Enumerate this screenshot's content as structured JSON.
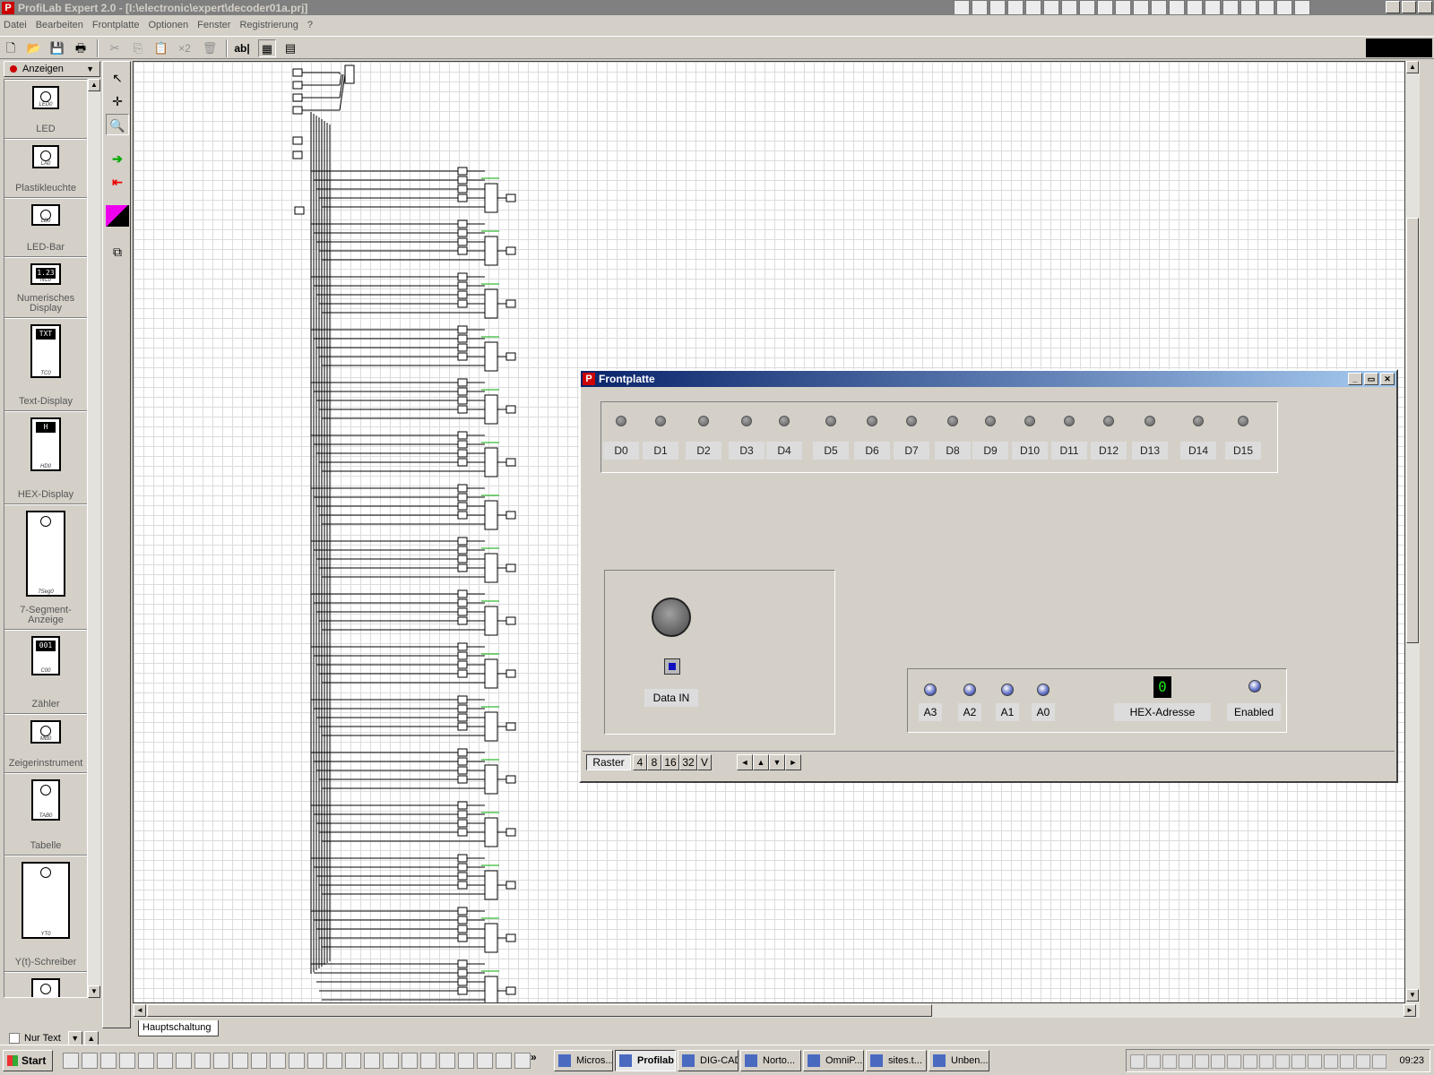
{
  "window": {
    "title": "ProfiLab Expert 2.0 - [I:\\electronic\\expert\\decoder01a.prj]",
    "app_icon": "P",
    "minimize": "_",
    "maximize": "▭",
    "close": "✕"
  },
  "menu": [
    "Datei",
    "Bearbeiten",
    "Frontplatte",
    "Optionen",
    "Fenster",
    "Registrierung",
    "?"
  ],
  "toolbar": {
    "new": "🗋",
    "open": "📂",
    "save": "💾",
    "print": "🖶",
    "cut": "✂",
    "copy": "⎘",
    "paste": "📋",
    "duplicate": "×2",
    "delete": "🗑",
    "text": "ab|",
    "grid1": "▦",
    "grid2": "▤"
  },
  "library": {
    "category": "Anzeigen",
    "items": [
      {
        "label": "LED",
        "icon": "led-icon",
        "tag": "LED0"
      },
      {
        "label": "Plastikleuchte",
        "icon": "lamp-icon",
        "tag": "LA0"
      },
      {
        "label": "LED-Bar",
        "icon": "led-bar-icon",
        "tag": "LB0"
      },
      {
        "label": "Numerisches Display",
        "icon": "numeric-display-icon",
        "tag": "NC0",
        "value": "1.23"
      },
      {
        "label": "Text-Display",
        "icon": "text-display-icon",
        "tag": "TC0",
        "value": "TXT"
      },
      {
        "label": "HEX-Display",
        "icon": "hex-display-icon",
        "tag": "HD0",
        "value": "H"
      },
      {
        "label": "7-Segment-Anzeige",
        "icon": "seven-segment-icon",
        "tag": "7Seg0"
      },
      {
        "label": "Zähler",
        "icon": "counter-icon",
        "tag": "C00",
        "value": "001"
      },
      {
        "label": "Zeigerinstrument",
        "icon": "meter-icon",
        "tag": "MB0"
      },
      {
        "label": "Tabelle",
        "icon": "table-icon",
        "tag": "TAB0"
      },
      {
        "label": "Y(t)-Schreiber",
        "icon": "yt-recorder-icon",
        "tag": "YT0"
      },
      {
        "label": "",
        "icon": "xy-recorder-icon",
        "tag": ""
      }
    ],
    "nur_text": "Nur Text"
  },
  "canvas": {
    "tab": "Hauptschaltung"
  },
  "frontplatte": {
    "title": "Frontplatte",
    "leds": [
      "D0",
      "D1",
      "D2",
      "D3",
      "D4",
      "D5",
      "D6",
      "D7",
      "D8",
      "D9",
      "D10",
      "D11",
      "D12",
      "D13",
      "D14",
      "D15"
    ],
    "data_in_label": "Data IN",
    "address_labels": [
      "A3",
      "A2",
      "A1",
      "A0"
    ],
    "hex_value": "0",
    "hex_label": "HEX-Adresse",
    "enabled_label": "Enabled",
    "bottom": {
      "raster": "Raster",
      "grid_options": [
        "4",
        "8",
        "16",
        "32",
        "V"
      ],
      "arrows": [
        "◄",
        "▲",
        "▼",
        "►"
      ]
    }
  },
  "taskbar": {
    "start": "Start",
    "tasks": [
      {
        "label": "Micros...",
        "active": false
      },
      {
        "label": "Profilab",
        "active": true
      },
      {
        "label": "DIG-CAD",
        "active": false
      },
      {
        "label": "Norto...",
        "active": false
      },
      {
        "label": "OmniP...",
        "active": false
      },
      {
        "label": "sites.t...",
        "active": false
      },
      {
        "label": "Unben...",
        "active": false
      }
    ],
    "chevron": "»",
    "clock": "09:23"
  }
}
